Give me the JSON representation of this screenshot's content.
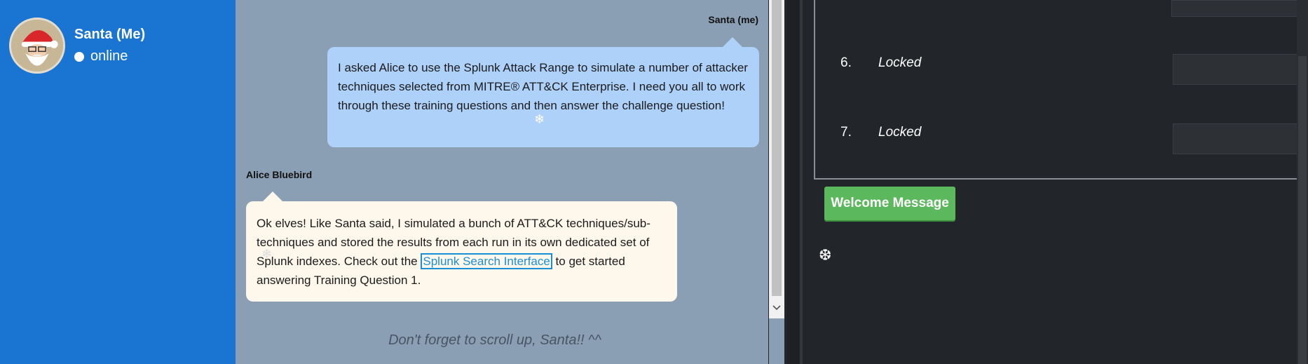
{
  "profile": {
    "name": "Santa (Me)",
    "status": "online"
  },
  "chat": {
    "messages": [
      {
        "sender": "Santa (me)",
        "text_before": "I asked Alice to use the Splunk Attack Range to simulate a number of attacker techniques selected from MITRE® ATT&CK Enterprise. I need you all to work through these training questions and then answer the challenge question!"
      },
      {
        "sender": "Alice Bluebird",
        "text_before": "Ok elves! Like Santa said, I simulated a bunch of ATT&CK techniques/sub-techniques and stored the results from each run in its own dedicated set of Splunk indexes. Check out the ",
        "link": "Splunk Search Interface",
        "text_after": " to get started answering Training Question 1."
      }
    ],
    "scroll_reminder": "Don't forget to scroll up, Santa!! ^^"
  },
  "questions": {
    "items": [
      {
        "number": "6.",
        "label": "Locked"
      },
      {
        "number": "7.",
        "label": "Locked"
      }
    ],
    "welcome_button": "Welcome Message"
  },
  "colors": {
    "sidebar": "#1a74d2",
    "chat_background": "#8a9fb4",
    "santa_bubble": "#aed1fa",
    "alice_bubble": "#fdf7ec",
    "accent_green": "#5cb85c",
    "link": "#1b8fd6"
  },
  "icons": [
    "santa-avatar",
    "status-dot-icon",
    "chevron-down-icon",
    "snowflake-icon"
  ]
}
